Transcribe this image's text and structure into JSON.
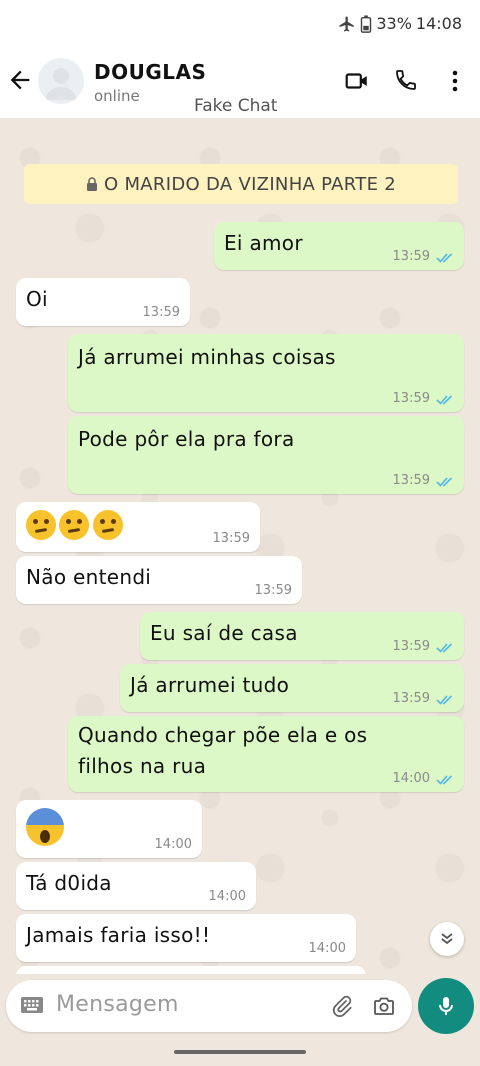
{
  "status_bar": {
    "battery": "33%",
    "time": "14:08"
  },
  "header": {
    "contact_name": "DOUGLAS",
    "contact_status": "online",
    "watermark": "Fake Chat"
  },
  "banner": {
    "text": "O MARIDO DA VIZINHA PARTE 2"
  },
  "messages": [
    {
      "dir": "out",
      "text": "Ei amor",
      "time": "13:59",
      "read": true
    },
    {
      "dir": "in",
      "text": "Oi",
      "time": "13:59"
    },
    {
      "dir": "out",
      "text": "Já arrumei minhas coisas",
      "time": "13:59",
      "read": true
    },
    {
      "dir": "out",
      "text": "Pode pôr ela pra fora",
      "time": "13:59",
      "read": true
    },
    {
      "dir": "in",
      "text": "🤔🤔🤔",
      "time": "13:59",
      "emoji": "thinking-face x3"
    },
    {
      "dir": "in",
      "text": "Não entendi",
      "time": "13:59"
    },
    {
      "dir": "out",
      "text": "Eu saí de casa",
      "time": "13:59",
      "read": true
    },
    {
      "dir": "out",
      "text": "Já arrumei tudo",
      "time": "13:59",
      "read": true
    },
    {
      "dir": "out",
      "text_line1": "Quando chegar põe ela e os",
      "text_line2": "filhos na rua",
      "time": "14:00",
      "read": true
    },
    {
      "dir": "in",
      "text": "😱",
      "time": "14:00",
      "emoji": "screaming-face"
    },
    {
      "dir": "in",
      "text": "Tá d0ida",
      "time": "14:00"
    },
    {
      "dir": "in",
      "text": "Jamais faria isso!!",
      "time": "14:00"
    }
  ],
  "composer": {
    "placeholder": "Mensagem"
  },
  "colors": {
    "outgoing": "#dcf8c6",
    "incoming": "#ffffff",
    "accent": "#128c7e",
    "read_ticks": "#4fb6ec",
    "background": "#efe7dd"
  }
}
